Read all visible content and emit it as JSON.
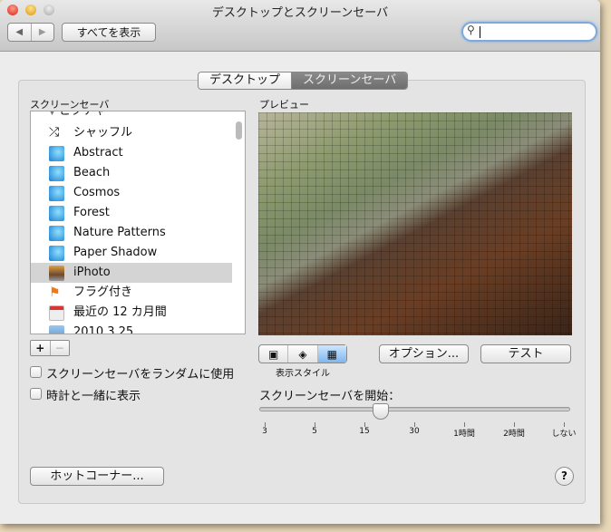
{
  "window": {
    "title": "デスクトップとスクリーンセーバ"
  },
  "toolbar": {
    "show_all": "すべてを表示",
    "search_value": ""
  },
  "tabs": [
    {
      "label": "デスクトップ",
      "selected": false
    },
    {
      "label": "スクリーンセーバ",
      "selected": true
    }
  ],
  "list": {
    "label": "スクリーンセーバ",
    "items": [
      {
        "label": "ピクチャ",
        "icon": "disclosure-triangle"
      },
      {
        "label": "シャッフル",
        "icon": "shuffle-icon"
      },
      {
        "label": "Abstract",
        "icon": "screensaver-icon"
      },
      {
        "label": "Beach",
        "icon": "screensaver-icon"
      },
      {
        "label": "Cosmos",
        "icon": "screensaver-icon"
      },
      {
        "label": "Forest",
        "icon": "screensaver-icon"
      },
      {
        "label": "Nature Patterns",
        "icon": "screensaver-icon"
      },
      {
        "label": "Paper Shadow",
        "icon": "screensaver-icon"
      },
      {
        "label": "iPhoto",
        "icon": "iphoto-icon",
        "selected": true
      },
      {
        "label": "フラグ付き",
        "icon": "flag-icon"
      },
      {
        "label": "最近の 12 カ月間",
        "icon": "calendar-icon"
      },
      {
        "label": "2010.3.25",
        "icon": "event-icon"
      }
    ]
  },
  "add_label": "+",
  "remove_label": "−",
  "checkboxes": [
    {
      "label": "スクリーンセーバをランダムに使用",
      "checked": false
    },
    {
      "label": "時計と一緒に表示",
      "checked": false
    }
  ],
  "hot_corners": "ホットコーナー...",
  "preview": {
    "label": "プレビュー"
  },
  "display_style": {
    "label": "表示スタイル",
    "options": [
      "slideshow",
      "collage",
      "mosaic"
    ],
    "selected": "mosaic"
  },
  "options_button": "オプション...",
  "test_button": "テスト",
  "start": {
    "label": "スクリーンセーバを開始：",
    "ticks": [
      "3",
      "5",
      "15",
      "30",
      "1時間",
      "2時間",
      "しない"
    ],
    "value": "20"
  },
  "help": "?"
}
